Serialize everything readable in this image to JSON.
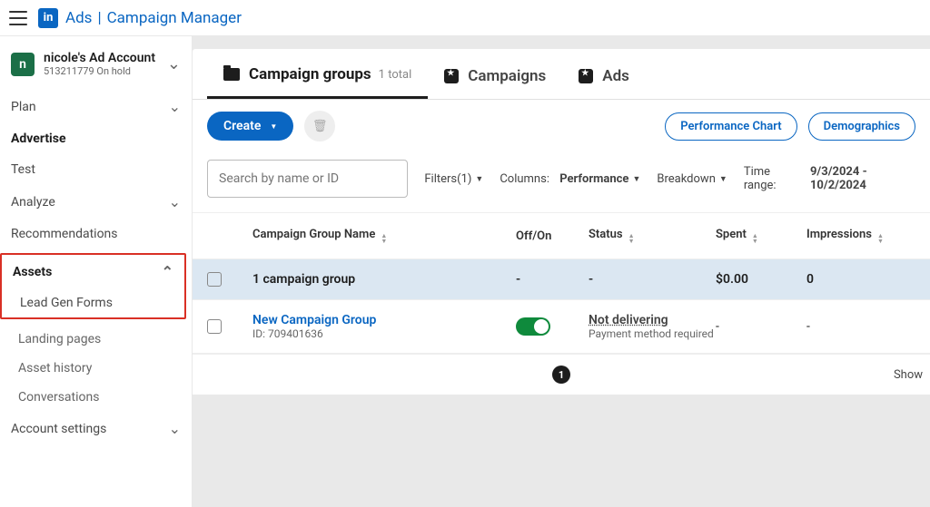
{
  "header": {
    "brand_ads": "Ads",
    "brand_sep": "|",
    "brand_cm": "Campaign Manager",
    "logo": "in"
  },
  "account": {
    "badge": "n",
    "name": "nicole's Ad Account",
    "id": "513211779",
    "status": "On hold"
  },
  "nav": {
    "plan": "Plan",
    "advertise": "Advertise",
    "test": "Test",
    "analyze": "Analyze",
    "recommendations": "Recommendations",
    "assets": "Assets",
    "lead_gen": "Lead Gen Forms",
    "landing": "Landing pages",
    "asset_history": "Asset history",
    "conversations": "Conversations",
    "account_settings": "Account settings"
  },
  "tabs": {
    "groups": "Campaign groups",
    "groups_count": "1 total",
    "campaigns": "Campaigns",
    "ads": "Ads"
  },
  "toolbar": {
    "create": "Create",
    "perf": "Performance Chart",
    "demo": "Demographics"
  },
  "filters": {
    "search_ph": "Search by name or ID",
    "filters": "Filters(1)",
    "columns_lbl": "Columns:",
    "columns_val": "Performance",
    "breakdown": "Breakdown",
    "time_lbl": "Time range:",
    "time_val": "9/3/2024 - 10/2/2024"
  },
  "cols": {
    "name": "Campaign Group Name",
    "toggle": "Off/On",
    "status": "Status",
    "spent": "Spent",
    "impr": "Impressions"
  },
  "summary": {
    "name": "1 campaign group",
    "toggle": "-",
    "status": "-",
    "spent": "$0.00",
    "impr": "0"
  },
  "row1": {
    "name": "New Campaign Group",
    "id": "ID: 709401636",
    "status": "Not delivering",
    "status_sub": "Payment method required",
    "spent": "-",
    "impr": "-"
  },
  "pager": {
    "page": "1",
    "show": "Show"
  }
}
